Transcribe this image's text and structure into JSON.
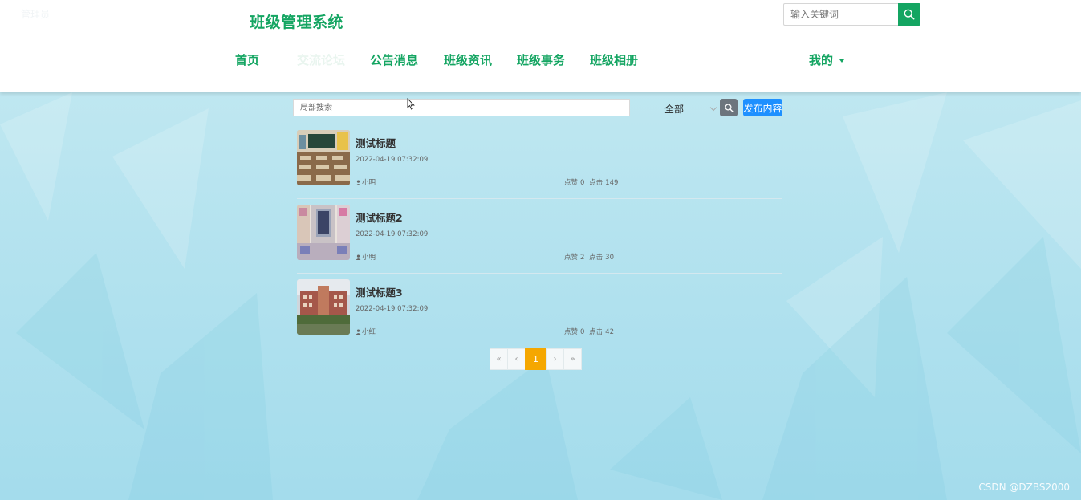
{
  "header": {
    "faint_user": "管理员",
    "site_title": "班级管理系统",
    "search_placeholder": "输入关键词",
    "nav": [
      {
        "label": "首页"
      },
      {
        "label": "交流论坛"
      },
      {
        "label": "公告消息"
      },
      {
        "label": "班级资讯"
      },
      {
        "label": "班级事务"
      },
      {
        "label": "班级相册"
      }
    ],
    "mine_label": "我的"
  },
  "filter": {
    "local_search_placeholder": "局部搜索",
    "select_value": "全部",
    "publish_label": "发布内容"
  },
  "posts": [
    {
      "title": "测试标题",
      "date": "2022-04-19 07:32:09",
      "author": "小明",
      "likes_label": "点赞",
      "likes": "0",
      "clicks_label": "点击",
      "clicks": "149"
    },
    {
      "title": "测试标题2",
      "date": "2022-04-19 07:32:09",
      "author": "小明",
      "likes_label": "点赞",
      "likes": "2",
      "clicks_label": "点击",
      "clicks": "30"
    },
    {
      "title": "测试标题3",
      "date": "2022-04-19 07:32:09",
      "author": "小红",
      "likes_label": "点赞",
      "likes": "0",
      "clicks_label": "点击",
      "clicks": "42"
    }
  ],
  "pagination": {
    "first": "«",
    "prev": "‹",
    "current": "1",
    "next": "›",
    "last": "»"
  },
  "watermark": "CSDN @DZBS2000",
  "colors": {
    "brand_green": "#14a562",
    "publish_blue": "#1e90ff",
    "page_current": "#f5a700",
    "search_gray": "#6c757d"
  }
}
